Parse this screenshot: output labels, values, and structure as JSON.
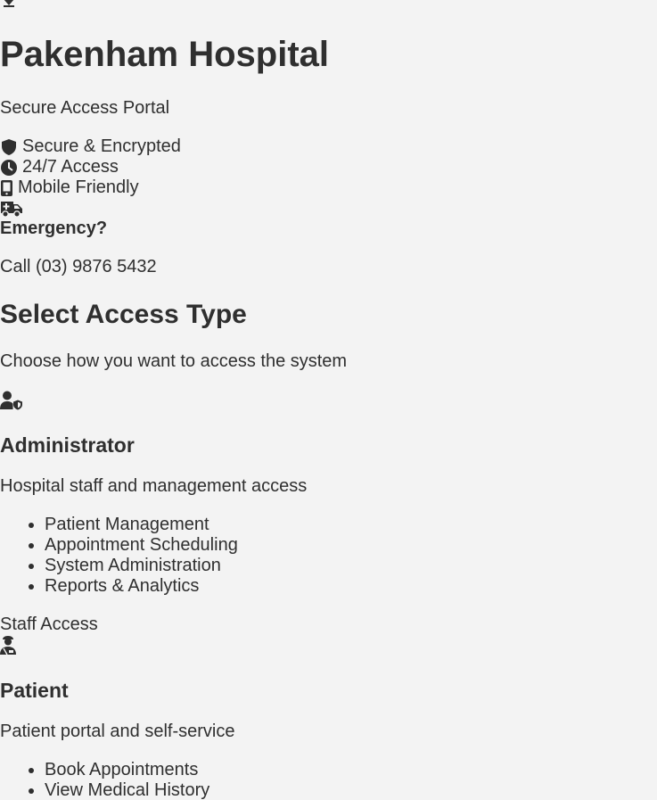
{
  "header": {
    "top_icon": "arrow-down-icon",
    "hospital_name": "Pakenham Hospital",
    "subtitle": "Secure Access Portal",
    "features": [
      {
        "icon": "shield-icon",
        "label": "Secure & Encrypted"
      },
      {
        "icon": "clock-icon",
        "label": "24/7 Access"
      },
      {
        "icon": "mobile-icon",
        "label": "Mobile Friendly"
      }
    ]
  },
  "emergency": {
    "icon": "ambulance-icon",
    "title": "Emergency?",
    "call": "Call (03) 9876 5432"
  },
  "access": {
    "title": "Select Access Type",
    "subtitle": "Choose how you want to access the system",
    "cards": [
      {
        "icon": "user-shield-icon",
        "title": "Administrator",
        "description": "Hospital staff and management access",
        "features": [
          "Patient Management",
          "Appointment Scheduling",
          "System Administration",
          "Reports & Analytics"
        ],
        "button": "Staff Access"
      },
      {
        "icon": "user-injured-icon",
        "title": "Patient",
        "description": "Patient portal and self-service",
        "features": [
          "Book Appointments",
          "View Medical History"
        ]
      }
    ]
  },
  "colors": {
    "background": "#f3f3f3",
    "text": "#2f2f2f"
  }
}
